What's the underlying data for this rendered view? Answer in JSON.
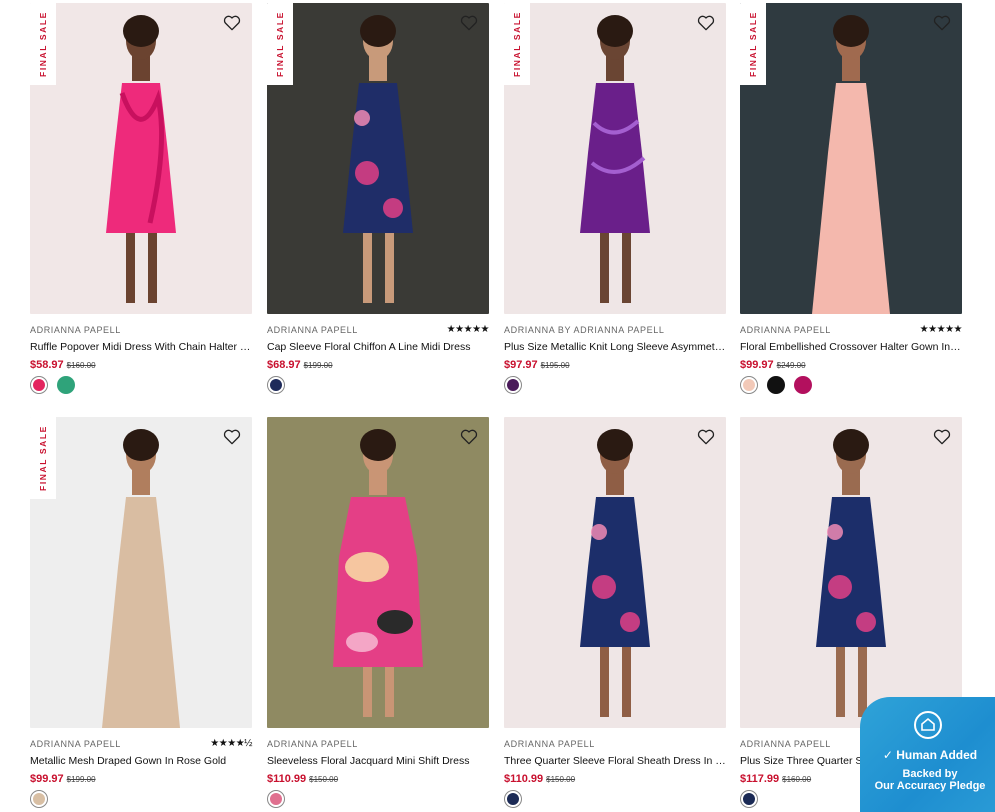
{
  "products": [
    {
      "brand": "ADRIANNA PAPELL",
      "name": "Ruffle Popover Midi Dress With Chain Halter Neckline",
      "sale_price": "$58.97",
      "original_price": "$160.00",
      "final_sale": "FINAL SALE",
      "rating": "",
      "swatches": [
        "#e3255e",
        "#2fa37a"
      ],
      "photo": {
        "bg": "#f1e7e7",
        "dress": "#ee2a7b",
        "skin": "#6b4330",
        "style": "ruffle"
      }
    },
    {
      "brand": "ADRIANNA PAPELL",
      "name": "Cap Sleeve Floral Chiffon A Line Midi Dress",
      "sale_price": "$68.97",
      "original_price": "$199.00",
      "final_sale": "FINAL SALE",
      "rating": "★★★★★",
      "swatches": [
        "#1e2a5a"
      ],
      "photo": {
        "bg": "#3a3a36",
        "dress": "#1f2d68",
        "skin": "#c89a7a",
        "style": "floral"
      }
    },
    {
      "brand": "ADRIANNA BY ADRIANNA PAPELL",
      "name": "Plus Size Metallic Knit Long Sleeve Asymmetric Dress",
      "sale_price": "$97.97",
      "original_price": "$195.00",
      "final_sale": "FINAL SALE",
      "rating": "",
      "swatches": [
        "#4a1a5a"
      ],
      "photo": {
        "bg": "#efe6e6",
        "dress": "#6a1f8a",
        "skin": "#6a4533",
        "style": "metallic"
      }
    },
    {
      "brand": "ADRIANNA PAPELL",
      "name": "Floral Embellished Crossover Halter Gown In Blush",
      "sale_price": "$99.97",
      "original_price": "$249.00",
      "final_sale": "FINAL SALE",
      "rating": "★★★★★",
      "swatches": [
        "#f2c9b8",
        "#111111",
        "#b3105e"
      ],
      "photo": {
        "bg": "#2f3a40",
        "dress": "#f4b8ad",
        "skin": "#a06a4f",
        "style": "gown"
      }
    },
    {
      "brand": "ADRIANNA PAPELL",
      "name": "Metallic Mesh Draped Gown In Rose Gold",
      "sale_price": "$99.97",
      "original_price": "$199.00",
      "final_sale": "FINAL SALE",
      "rating": "★★★★½",
      "swatches": [
        "#d8bfa4"
      ],
      "photo": {
        "bg": "#eeeeee",
        "dress": "#d9bda2",
        "skin": "#b07e5e",
        "style": "gown"
      }
    },
    {
      "brand": "ADRIANNA PAPELL",
      "name": "Sleeveless Floral Jacquard Mini Shift Dress",
      "sale_price": "$110.99",
      "original_price": "$150.00",
      "final_sale": "",
      "rating": "",
      "swatches": [
        "#e0708f"
      ],
      "photo": {
        "bg": "#8f8a62",
        "dress": "#e43f86",
        "skin": "#c99575",
        "style": "shift"
      }
    },
    {
      "brand": "ADRIANNA PAPELL",
      "name": "Three Quarter Sleeve Floral Sheath Dress In Navy",
      "sale_price": "$110.99",
      "original_price": "$150.00",
      "final_sale": "",
      "rating": "",
      "swatches": [
        "#1b2a55"
      ],
      "photo": {
        "bg": "#efe6e6",
        "dress": "#1c2e6a",
        "skin": "#8f5e45",
        "style": "sheath"
      }
    },
    {
      "brand": "ADRIANNA PAPELL",
      "name": "Plus Size Three Quarter Sleeve Floral Sheath Dress",
      "sale_price": "$117.99",
      "original_price": "$160.00",
      "final_sale": "",
      "rating": "",
      "swatches": [
        "#1b2a55"
      ],
      "photo": {
        "bg": "#efe6e6",
        "dress": "#1c2e6a",
        "skin": "#9a6b50",
        "style": "sheath"
      }
    }
  ],
  "badge": {
    "line1": "Human Added",
    "line2": "Backed by",
    "line3": "Our Accuracy Pledge",
    "color": "#1e8ed0"
  }
}
